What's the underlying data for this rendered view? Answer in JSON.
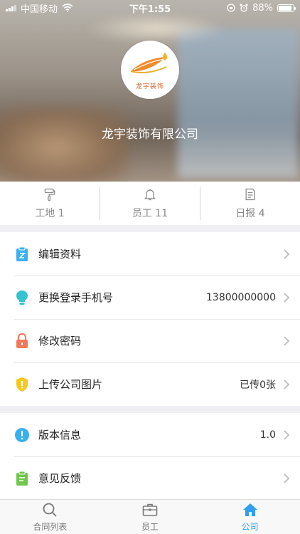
{
  "status_bar": {
    "carrier": "中国移动",
    "time": "下午1:55",
    "battery": "88%",
    "battery_level": 0.88
  },
  "header": {
    "company_name": "龙宇装饰有限公司",
    "logo_text": "龙宇装饰"
  },
  "stats": [
    {
      "label": "工地 1",
      "icon": "paint-roller-icon"
    },
    {
      "label": "员工 11",
      "icon": "bell-icon"
    },
    {
      "label": "日报 4",
      "icon": "report-icon"
    }
  ],
  "menu1": [
    {
      "label": "编辑资料",
      "value": "",
      "icon": "edit-icon",
      "color": "#3ab0f0"
    },
    {
      "label": "更换登录手机号",
      "value": "13800000000",
      "icon": "lightbulb-icon",
      "color": "#35c3d0"
    },
    {
      "label": "修改密码",
      "value": "",
      "icon": "lock-icon",
      "color": "#f07a5c"
    },
    {
      "label": "上传公司图片",
      "value": "已传0张",
      "icon": "shield-icon",
      "color": "#f5c820"
    }
  ],
  "menu2": [
    {
      "label": "版本信息",
      "value": "1.0",
      "icon": "info-icon",
      "color": "#3ab0f0"
    },
    {
      "label": "意见反馈",
      "value": "",
      "icon": "clipboard-icon",
      "color": "#6fc74a"
    }
  ],
  "tabs": [
    {
      "label": "合同列表",
      "icon": "search-icon"
    },
    {
      "label": "员工",
      "icon": "briefcase-icon"
    },
    {
      "label": "公司",
      "icon": "home-icon",
      "active": true
    }
  ],
  "colors": {
    "accent": "#2f9ff0"
  }
}
